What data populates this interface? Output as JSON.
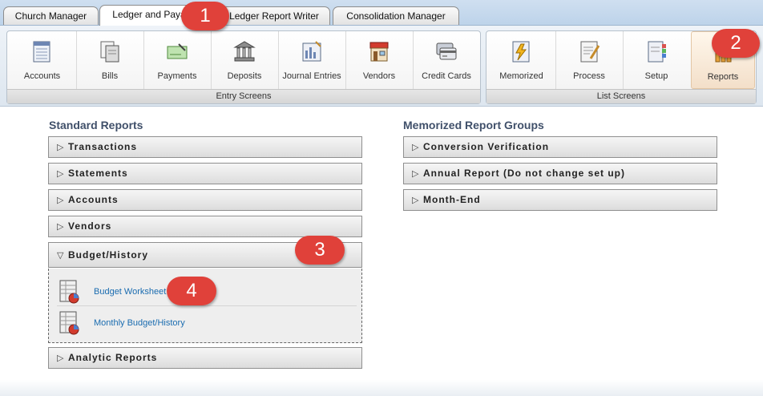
{
  "tabs": [
    {
      "label": "Church Manager"
    },
    {
      "label": "Ledger and Payables"
    },
    {
      "label": "Ledger Report Writer"
    },
    {
      "label": "Consolidation Manager"
    }
  ],
  "entry_screens": {
    "group_label": "Entry Screens",
    "buttons": [
      {
        "label": "Accounts",
        "icon": "accounts-ledger-icon"
      },
      {
        "label": "Bills",
        "icon": "bills-icon"
      },
      {
        "label": "Payments",
        "icon": "payments-check-icon"
      },
      {
        "label": "Deposits",
        "icon": "deposits-bank-icon"
      },
      {
        "label": "Journal Entries",
        "icon": "journal-entries-icon"
      },
      {
        "label": "Vendors",
        "icon": "vendors-storefront-icon"
      },
      {
        "label": "Credit Cards",
        "icon": "credit-cards-icon"
      }
    ]
  },
  "list_screens": {
    "group_label": "List Screens",
    "buttons": [
      {
        "label": "Memorized",
        "icon": "memorized-icon"
      },
      {
        "label": "Process",
        "icon": "process-icon"
      },
      {
        "label": "Setup",
        "icon": "setup-icon"
      },
      {
        "label": "Reports",
        "icon": "reports-icon"
      }
    ]
  },
  "standard_reports": {
    "title": "Standard Reports",
    "sections": [
      {
        "label": "Transactions"
      },
      {
        "label": "Statements"
      },
      {
        "label": "Accounts"
      },
      {
        "label": "Vendors"
      },
      {
        "label": "Budget/History"
      },
      {
        "label": "Analytic Reports"
      }
    ],
    "budget_items": [
      {
        "label": "Budget Worksheet",
        "icon": "report-sheet-icon"
      },
      {
        "label": "Monthly Budget/History",
        "icon": "report-sheet-icon"
      }
    ]
  },
  "memorized_groups": {
    "title": "Memorized Report Groups",
    "sections": [
      {
        "label": "Conversion Verification"
      },
      {
        "label": "Annual Report (Do not change set up)"
      },
      {
        "label": "Month-End"
      }
    ]
  },
  "badges": [
    "1",
    "2",
    "3",
    "4"
  ],
  "colors": {
    "badge": "#e0413a",
    "link": "#1a6cb0",
    "section_title": "#40506a"
  }
}
